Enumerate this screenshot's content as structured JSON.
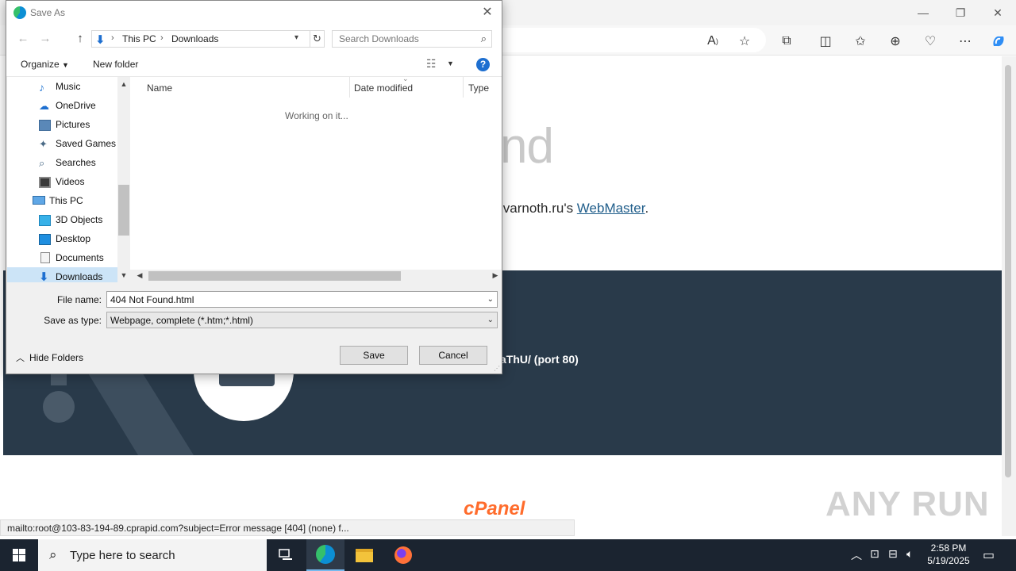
{
  "browser": {
    "window_controls": {
      "minimize": "—",
      "restore": "❐",
      "close": "✕"
    },
    "page": {
      "heading_fragment": "nd",
      "message_prefix": "ivarnoth.ru's ",
      "message_link": "WebMaster",
      "message_suffix": ".",
      "band_text": "aThU/ (port 80)",
      "brand": "cPanel",
      "watermark": "ANY RUN"
    },
    "status_url": "mailto:root@103-83-194-89.cprapid.com?subject=Error message [404] (none) f..."
  },
  "dialog": {
    "title": "Save As",
    "address": {
      "crumbs": [
        "This PC",
        "Downloads"
      ]
    },
    "search_placeholder": "Search Downloads",
    "commands": {
      "organize": "Organize",
      "new_folder": "New folder",
      "help": "?"
    },
    "nav_items": [
      {
        "label": "Music",
        "icon": "music-icon"
      },
      {
        "label": "OneDrive",
        "icon": "cloud-icon"
      },
      {
        "label": "Pictures",
        "icon": "pictures-icon"
      },
      {
        "label": "Saved Games",
        "icon": "games-icon"
      },
      {
        "label": "Searches",
        "icon": "search-icon"
      },
      {
        "label": "Videos",
        "icon": "video-icon"
      },
      {
        "label": "This PC",
        "icon": "computer-icon"
      },
      {
        "label": "3D Objects",
        "icon": "cube-icon"
      },
      {
        "label": "Desktop",
        "icon": "desktop-icon"
      },
      {
        "label": "Documents",
        "icon": "documents-icon"
      },
      {
        "label": "Downloads",
        "icon": "download-icon",
        "selected": true
      }
    ],
    "columns": [
      "Name",
      "Date modified",
      "Type"
    ],
    "status": "Working on it...",
    "file_name_label": "File name:",
    "file_name": "404 Not Found.html",
    "save_type_label": "Save as type:",
    "save_type": "Webpage, complete (*.htm;*.html)",
    "hide_folders": "Hide Folders",
    "save_button": "Save",
    "cancel_button": "Cancel"
  },
  "taskbar": {
    "search_placeholder": "Type here to search",
    "time": "2:58 PM",
    "date": "5/19/2025"
  }
}
